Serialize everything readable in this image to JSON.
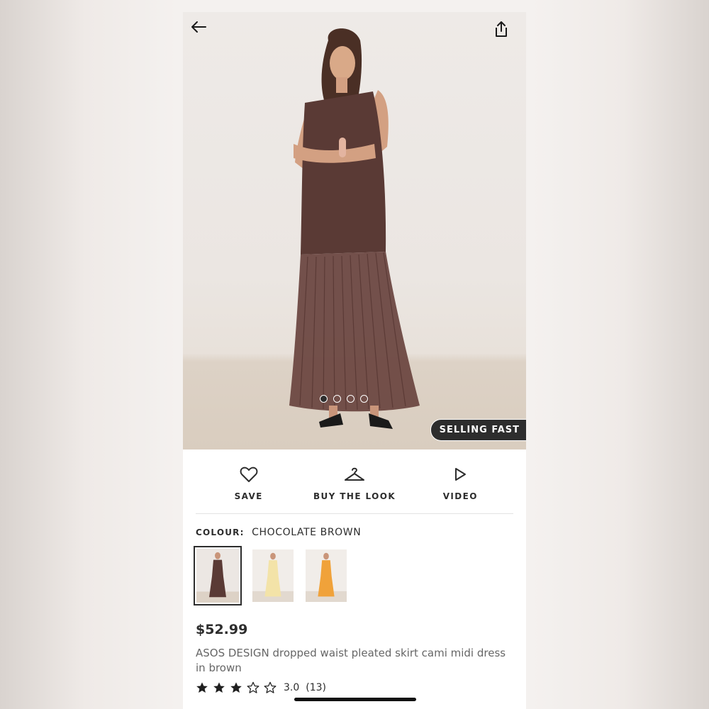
{
  "badge": {
    "label": "SELLING FAST"
  },
  "carousel": {
    "total": 4,
    "current": 1
  },
  "actions": [
    {
      "label": "SAVE",
      "icon": "heart-icon"
    },
    {
      "label": "BUY THE LOOK",
      "icon": "hanger-icon"
    },
    {
      "label": "VIDEO",
      "icon": "play-icon"
    }
  ],
  "colour": {
    "key": "COLOUR:",
    "value": "CHOCOLATE BROWN",
    "swatches": [
      {
        "color": "#5a3a35",
        "selected": true
      },
      {
        "color": "#f3e3a8",
        "selected": false
      },
      {
        "color": "#f0a23a",
        "selected": false
      }
    ]
  },
  "product": {
    "price": "$52.99",
    "title": "ASOS DESIGN dropped waist pleated skirt cami midi dress in brown",
    "rating": {
      "score": "3.0",
      "count": "(13)",
      "stars_filled": 3,
      "stars_total": 5
    }
  },
  "colors": {
    "text": "#2d2d2d",
    "muted": "#666666",
    "dress": "#5a3a35"
  }
}
